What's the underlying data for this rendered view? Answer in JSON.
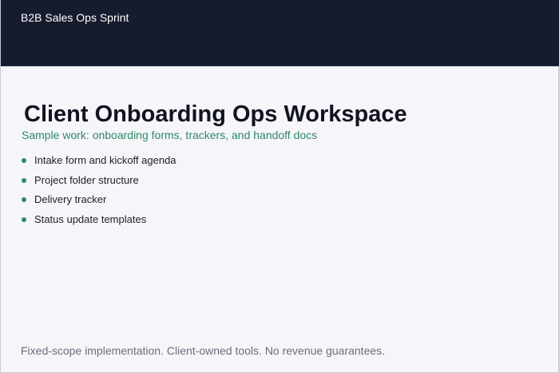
{
  "header": {
    "brand": "B2B Sales Ops Sprint"
  },
  "main": {
    "title": "Client Onboarding Ops Workspace",
    "subtitle": "Sample work: onboarding forms, trackers, and handoff docs",
    "items": [
      {
        "label": "Intake form and kickoff agenda"
      },
      {
        "label": "Project folder structure"
      },
      {
        "label": "Delivery tracker"
      },
      {
        "label": "Status update templates"
      }
    ]
  },
  "footer": {
    "note": "Fixed-scope implementation. Client-owned tools. No revenue guarantees."
  },
  "colors": {
    "header_bg": "#161b2e",
    "accent": "#2e8a64",
    "page_bg": "#f5f5fa"
  }
}
